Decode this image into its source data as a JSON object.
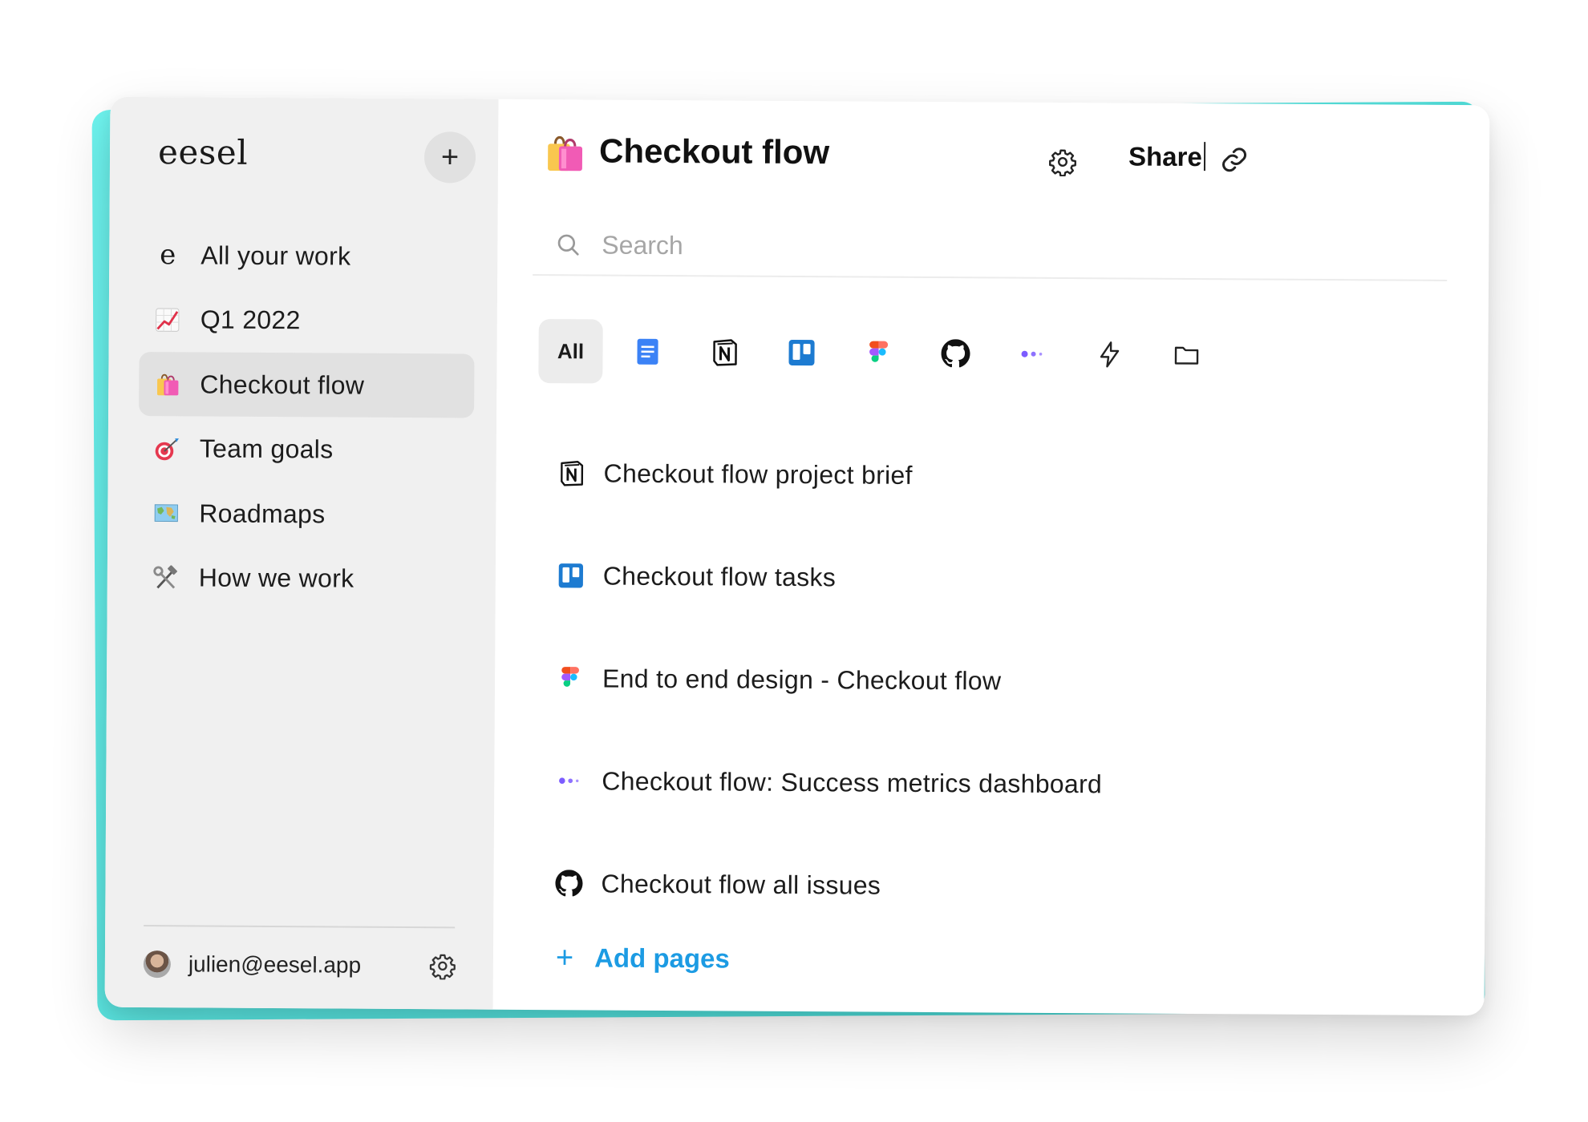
{
  "app": {
    "logo_text": "eesel",
    "add_button_label": "+"
  },
  "sidebar": {
    "items": [
      {
        "label": "All your work",
        "icon": "eesel-e-icon",
        "active": false
      },
      {
        "label": "Q1 2022",
        "icon": "chart-increasing-emoji",
        "active": false
      },
      {
        "label": "Checkout flow",
        "icon": "shopping-bags-emoji",
        "active": true
      },
      {
        "label": "Team goals",
        "icon": "direct-hit-emoji",
        "active": false
      },
      {
        "label": "Roadmaps",
        "icon": "world-map-emoji",
        "active": false
      },
      {
        "label": "How we work",
        "icon": "hammer-and-wrench-emoji",
        "active": false
      }
    ],
    "user": {
      "email": "julien@eesel.app",
      "avatar": "user-avatar",
      "settings_icon": "gear-icon"
    }
  },
  "header": {
    "title": "Checkout flow",
    "emoji": "shopping-bags-emoji",
    "settings_icon": "gear-icon",
    "share_label": "Share",
    "link_icon": "link-icon"
  },
  "search": {
    "placeholder": "Search",
    "value": ""
  },
  "filters": [
    {
      "label": "All",
      "active": true
    },
    {
      "icon": "google-docs-icon"
    },
    {
      "icon": "notion-icon"
    },
    {
      "icon": "trello-icon"
    },
    {
      "icon": "figma-icon"
    },
    {
      "icon": "github-icon"
    },
    {
      "icon": "dots-app-icon"
    },
    {
      "icon": "lightning-icon"
    },
    {
      "icon": "folder-icon"
    }
  ],
  "results": [
    {
      "title": "Checkout flow project brief",
      "icon": "notion-icon"
    },
    {
      "title": "Checkout flow tasks",
      "icon": "trello-icon"
    },
    {
      "title": "End to end design - Checkout flow",
      "icon": "figma-icon"
    },
    {
      "title": "Checkout flow: Success metrics dashboard",
      "icon": "dots-app-icon"
    },
    {
      "title": "Checkout flow all issues",
      "icon": "github-icon"
    }
  ],
  "add_pages": {
    "plus": "+",
    "label": "Add pages"
  },
  "colors": {
    "accent": "#1c9be3",
    "glow": "#4fe3df",
    "sidebar_bg": "#f0f0f0",
    "active_item_bg": "#e1e1e1"
  }
}
